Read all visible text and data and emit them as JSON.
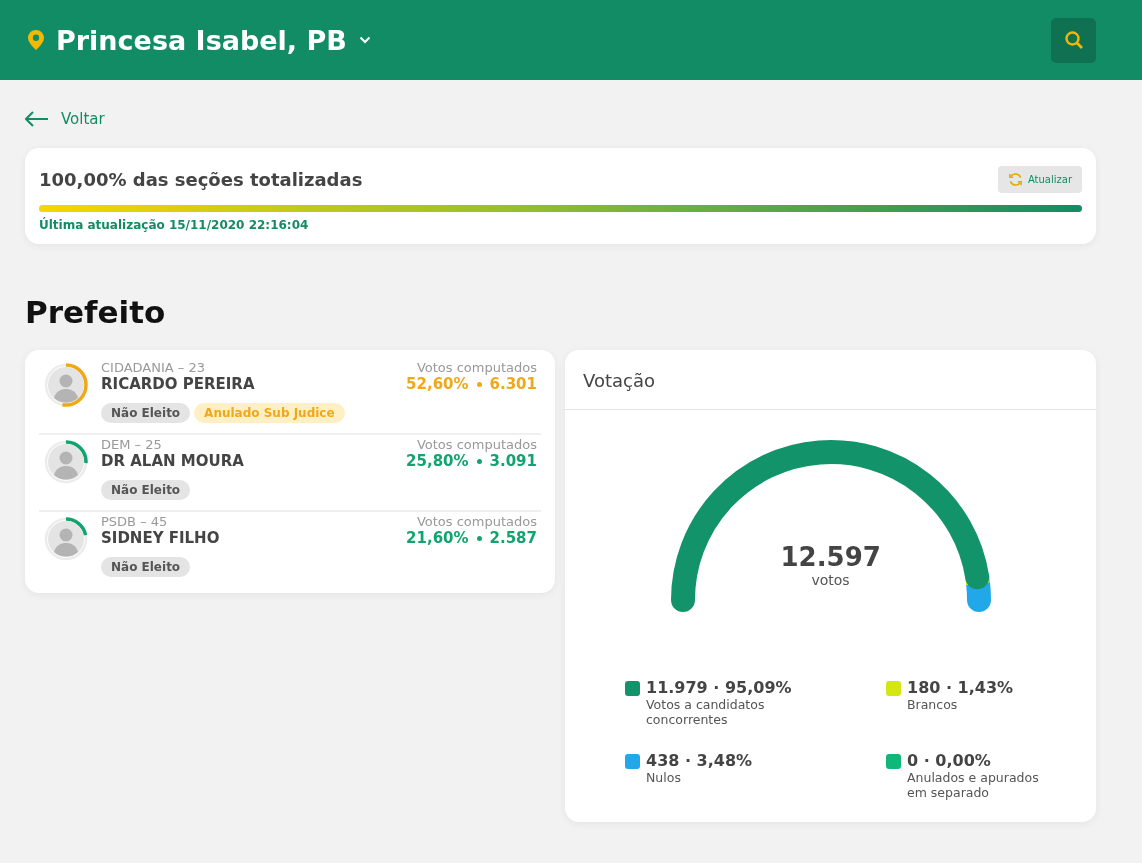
{
  "header": {
    "city": "Princesa Isabel, PB"
  },
  "back_link": "Voltar",
  "progress": {
    "title": "100,00% das seções totalizadas",
    "refresh_button": "Atualizar",
    "level": 1,
    "updated": "Última atualização 15/11/2020 22:16:04"
  },
  "office": "Prefeito",
  "candidates": [
    {
      "party": "CIDADANIA – 23",
      "name": "RICARDO PEREIRA",
      "votes_label": "Votos computados",
      "percent": "52,60%",
      "votes": "6.301",
      "color": "#f0a818",
      "tags": [
        {
          "label": "Não Eleito",
          "kind": "neutral"
        },
        {
          "label": "Anulado Sub Judice",
          "kind": "warning"
        }
      ]
    },
    {
      "party": "DEM – 25",
      "name": "DR ALAN MOURA",
      "votes_label": "Votos computados",
      "percent": "25,80%",
      "votes": "3.091",
      "color": "#12a46e",
      "tags": [
        {
          "label": "Não Eleito",
          "kind": "neutral"
        }
      ]
    },
    {
      "party": "PSDB – 45",
      "name": "SIDNEY FILHO",
      "votes_label": "Votos computados",
      "percent": "21,60%",
      "votes": "2.587",
      "color": "#12a46e",
      "tags": [
        {
          "label": "Não Eleito",
          "kind": "neutral"
        }
      ]
    }
  ],
  "votacao": {
    "title": "Votação",
    "total": "12.597",
    "total_label": "votos",
    "legend": [
      {
        "value": "11.979 · 95,09%",
        "label": "Votos a candidatos concorrentes",
        "color": "#13936a"
      },
      {
        "value": "180 · 1,43%",
        "label": "Brancos",
        "color": "#d4e614"
      },
      {
        "value": "438 · 3,48%",
        "label": "Nulos",
        "color": "#22a8e8"
      },
      {
        "value": "0 · 0,00%",
        "label": "Anulados e apurados em separado",
        "color": "#10b77a"
      }
    ]
  }
}
